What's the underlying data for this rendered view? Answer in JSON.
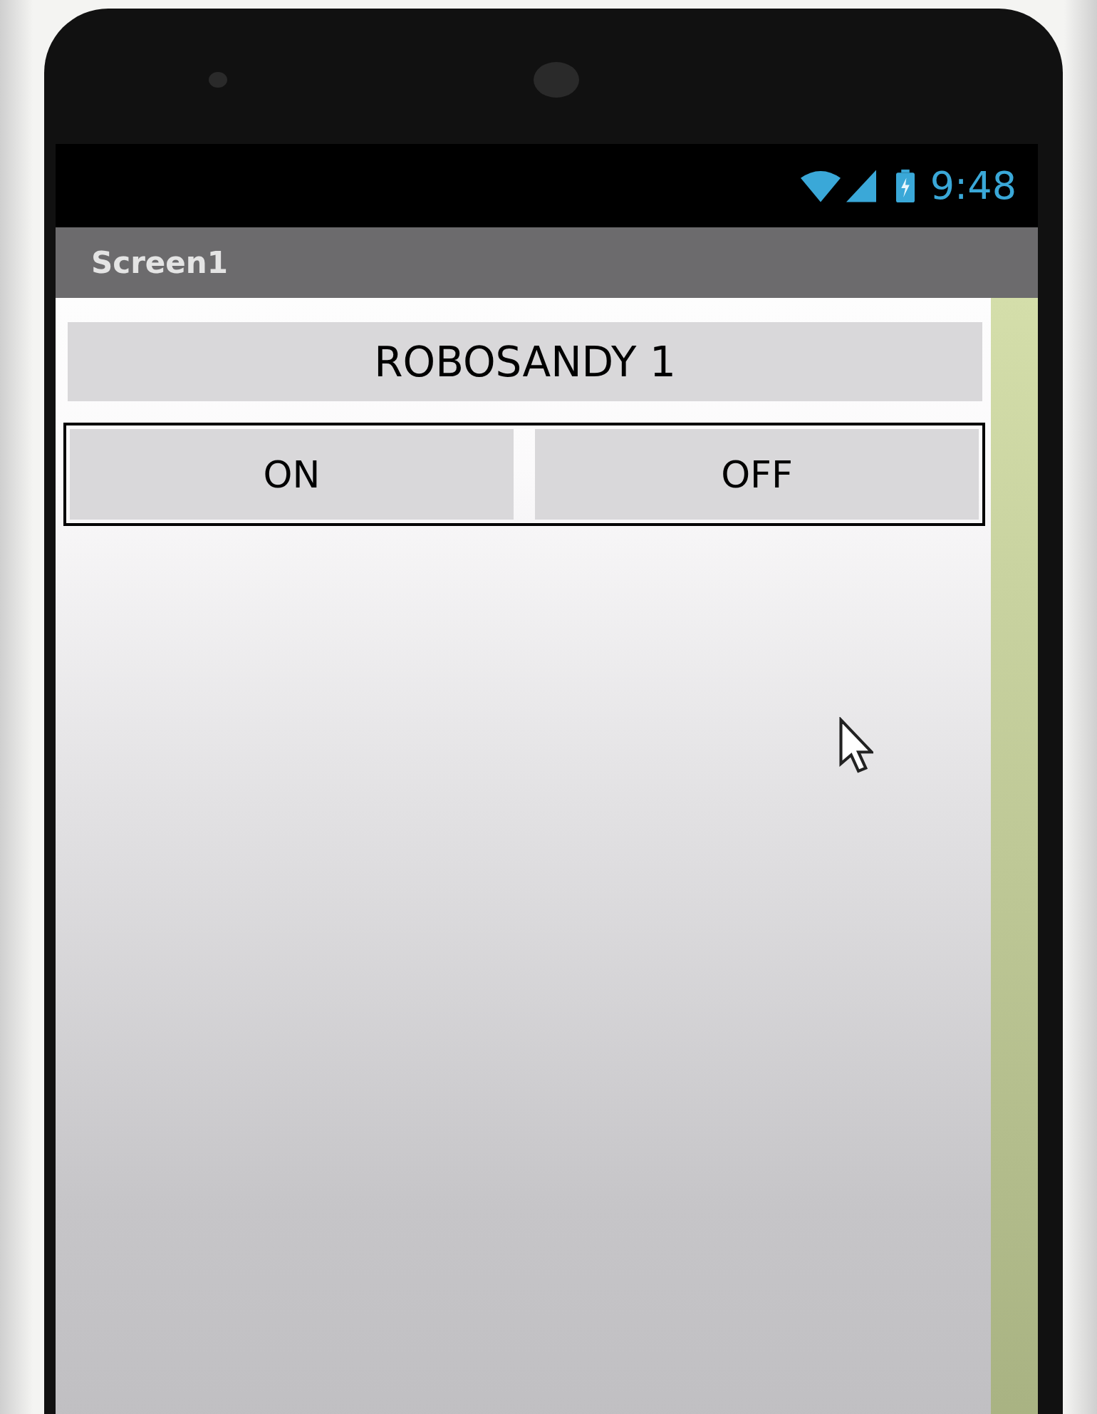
{
  "status_bar": {
    "time": "9:48"
  },
  "title_bar": {
    "title": "Screen1"
  },
  "label": {
    "text": "ROBOSANDY 1"
  },
  "buttons": [
    {
      "label": "ON"
    },
    {
      "label": "OFF"
    }
  ]
}
